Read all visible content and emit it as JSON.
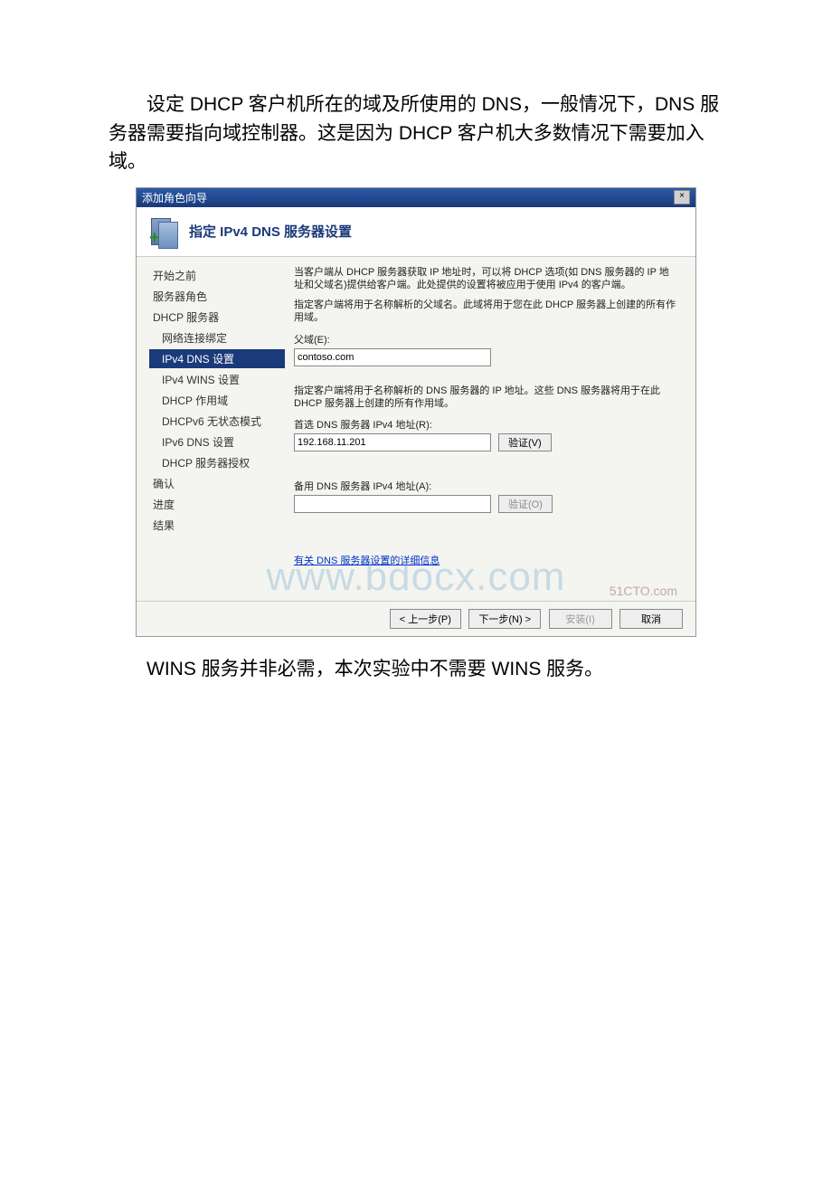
{
  "para1": "设定 DHCP 客户机所在的域及所使用的 DNS，一般情况下，DNS 服务器需要指向域控制器。这是因为 DHCP 客户机大多数情况下需要加入域。",
  "para2": "WINS 服务并非必需，本次实验中不需要 WINS 服务。",
  "dialog": {
    "titlebar": "添加角色向导",
    "header_title": "指定 IPv4 DNS 服务器设置",
    "sidebar": {
      "items": [
        {
          "label": "开始之前",
          "cls": ""
        },
        {
          "label": "服务器角色",
          "cls": ""
        },
        {
          "label": "DHCP 服务器",
          "cls": ""
        },
        {
          "label": "网络连接绑定",
          "cls": "sub"
        },
        {
          "label": "IPv4 DNS 设置",
          "cls": "sub selected"
        },
        {
          "label": "IPv4 WINS 设置",
          "cls": "sub"
        },
        {
          "label": "DHCP 作用域",
          "cls": "sub"
        },
        {
          "label": "DHCPv6 无状态模式",
          "cls": "sub"
        },
        {
          "label": "IPv6 DNS 设置",
          "cls": "sub"
        },
        {
          "label": "DHCP 服务器授权",
          "cls": "sub"
        },
        {
          "label": "确认",
          "cls": ""
        },
        {
          "label": "进度",
          "cls": ""
        },
        {
          "label": "结果",
          "cls": ""
        }
      ]
    },
    "content": {
      "desc1": "当客户端从 DHCP 服务器获取 IP 地址时，可以将 DHCP 选项(如 DNS 服务器的 IP 地址和父域名)提供给客户端。此处提供的设置将被应用于使用 IPv4 的客户端。",
      "desc2": "指定客户端将用于名称解析的父域名。此域将用于您在此 DHCP 服务器上创建的所有作用域。",
      "parent_label": "父域(E):",
      "parent_value": "contoso.com",
      "desc3": "指定客户端将用于名称解析的 DNS 服务器的 IP 地址。这些 DNS 服务器将用于在此 DHCP 服务器上创建的所有作用域。",
      "pref_label": "首选 DNS 服务器 IPv4 地址(R):",
      "pref_value": "192.168.11.201",
      "alt_label": "备用 DNS 服务器 IPv4 地址(A):",
      "alt_value": "",
      "verify": "验证(V)",
      "verify2": "验证(O)",
      "link": "有关 DNS 服务器设置的详细信息"
    },
    "footer": {
      "prev": "< 上一步(P)",
      "next": "下一步(N) >",
      "install": "安装(I)",
      "cancel": "取消"
    },
    "watermark": "www.bdocx.com",
    "watermark2": "51CTO.com"
  }
}
